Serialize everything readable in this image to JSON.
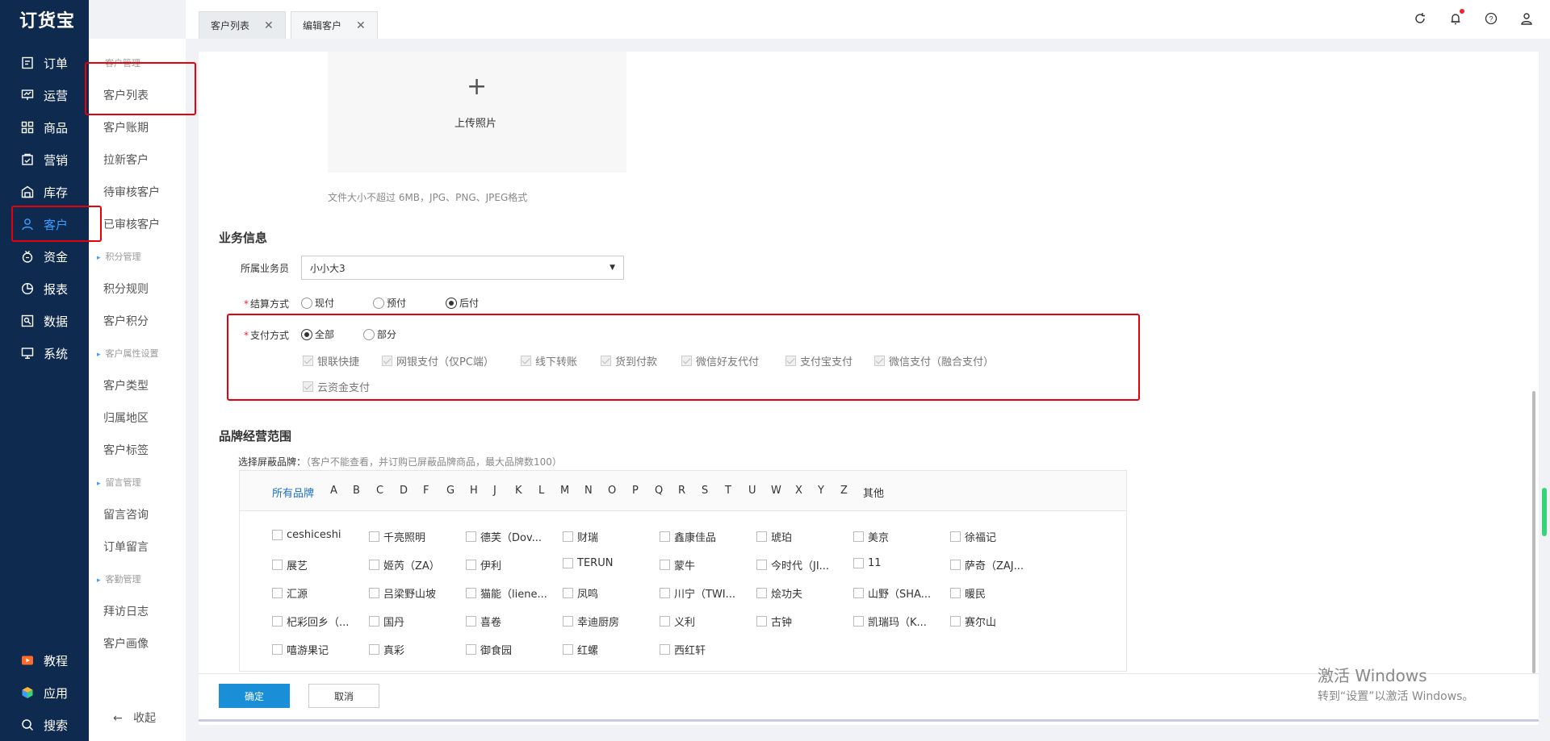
{
  "app": {
    "logo": "订货宝"
  },
  "nav": {
    "items": [
      {
        "label": "订单",
        "icon": "order-icon"
      },
      {
        "label": "运营",
        "icon": "operation-icon"
      },
      {
        "label": "商品",
        "icon": "goods-icon"
      },
      {
        "label": "营销",
        "icon": "marketing-icon"
      },
      {
        "label": "库存",
        "icon": "warehouse-icon"
      },
      {
        "label": "客户",
        "icon": "user-icon",
        "active": true
      },
      {
        "label": "资金",
        "icon": "money-icon"
      },
      {
        "label": "报表",
        "icon": "pie-chart-icon"
      },
      {
        "label": "数据",
        "icon": "data-icon"
      },
      {
        "label": "系统",
        "icon": "monitor-icon"
      }
    ],
    "bottom": [
      {
        "label": "教程",
        "icon": "video-icon"
      },
      {
        "label": "应用",
        "icon": "cube-icon"
      },
      {
        "label": "搜索",
        "icon": "search-icon"
      }
    ]
  },
  "subnav": {
    "groups": {
      "customer_manage": "客户管理",
      "points_manage": "积分管理",
      "attr_settings": "客户属性设置",
      "message_manage": "留言管理",
      "visit_manage": "客勤管理"
    },
    "items": {
      "customer_list": "客户列表",
      "customer_credit": "客户账期",
      "new_customer": "拉新客户",
      "pending": "待审核客户",
      "approved": "已审核客户",
      "points_rule": "积分规则",
      "customer_points": "客户积分",
      "customer_type": "客户类型",
      "region": "归属地区",
      "customer_tag": "客户标签",
      "message_consult": "留言咨询",
      "order_message": "订单留言",
      "visit_log": "拜访日志",
      "customer_portrait": "客户画像"
    },
    "collapse": "收起"
  },
  "tabs": [
    {
      "label": "客户列表"
    },
    {
      "label": "编辑客户",
      "active": true
    }
  ],
  "upload": {
    "plus": "+",
    "label": "上传照片",
    "hint": "文件大小不超过 6MB，JPG、PNG、JPEG格式"
  },
  "business": {
    "title": "业务信息",
    "salesman_label": "所属业务员",
    "salesman_value": "小小大3",
    "settlement_label": "结算方式",
    "settlement_options": [
      "现付",
      "预付",
      "后付"
    ],
    "settlement_selected": "后付",
    "payment_label": "支付方式",
    "payment_scope_options": [
      "全部",
      "部分"
    ],
    "payment_scope_selected": "全部",
    "payment_methods": [
      "银联快捷",
      "网银支付（仅PC端）",
      "线下转账",
      "货到付款",
      "微信好友代付",
      "支付宝支付",
      "微信支付（融合支付）",
      "云资金支付"
    ]
  },
  "brand": {
    "title": "品牌经营范围",
    "hint_label": "选择屏蔽品牌：",
    "hint_note": "（客户不能查看，并订购已屏蔽品牌商品，最大品牌数100）",
    "letters": [
      "所有品牌",
      "A",
      "B",
      "C",
      "D",
      "F",
      "G",
      "H",
      "J",
      "K",
      "L",
      "M",
      "N",
      "O",
      "P",
      "Q",
      "R",
      "S",
      "T",
      "U",
      "W",
      "X",
      "Y",
      "Z",
      "其他"
    ],
    "brands": [
      [
        "ceshiceshi",
        "千亮照明",
        "德芙（Dov...",
        "财瑞",
        "鑫康佳品",
        "琥珀",
        "美京",
        "徐福记"
      ],
      [
        "展艺",
        "姬芮（ZA）",
        "伊利",
        "TERUN",
        "蒙牛",
        "今时代（JI...",
        "11",
        "萨奇（ZAJ..."
      ],
      [
        "汇源",
        "吕梁野山坡",
        "猫能（liene...",
        "凤鸣",
        "川宁（TWI...",
        "烩功夫",
        "山野（SHA...",
        "暖民"
      ],
      [
        "杞彩回乡（...",
        "国丹",
        "喜卷",
        "幸迪厨房",
        "义利",
        "古钟",
        "凯瑞玛（K...",
        "赛尔山"
      ],
      [
        "嘻游果记",
        "真彩",
        "御食园",
        "红螺",
        "西红轩"
      ]
    ]
  },
  "actions": {
    "ok": "确定",
    "cancel": "取消"
  },
  "watermark": {
    "line1": "激活 Windows",
    "line2": "转到“设置”以激活 Windows。"
  },
  "colors": {
    "nav_bg": "#0f2a4f",
    "accent": "#1a8fd8",
    "highlight": "#e8000b"
  }
}
